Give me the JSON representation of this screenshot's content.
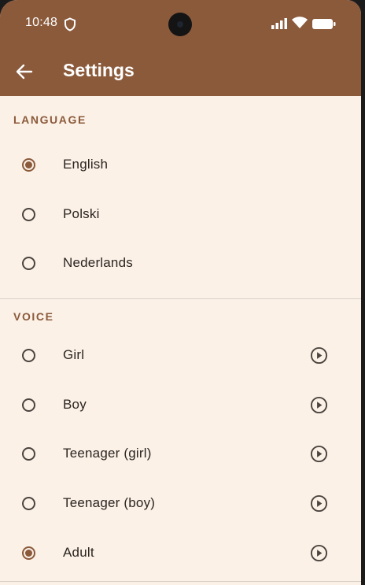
{
  "status_bar": {
    "time": "10:48"
  },
  "app_bar": {
    "title": "Settings"
  },
  "language": {
    "header": "LANGUAGE",
    "options": [
      {
        "label": "English",
        "selected": true
      },
      {
        "label": "Polski",
        "selected": false
      },
      {
        "label": "Nederlands",
        "selected": false
      }
    ]
  },
  "voice": {
    "header": "VOICE",
    "options": [
      {
        "label": "Girl",
        "selected": false
      },
      {
        "label": "Boy",
        "selected": false
      },
      {
        "label": "Teenager (girl)",
        "selected": false
      },
      {
        "label": "Teenager (boy)",
        "selected": false
      },
      {
        "label": "Adult",
        "selected": true
      }
    ]
  },
  "colors": {
    "accent": "#8b5a3b",
    "background": "#fbf1e7"
  }
}
